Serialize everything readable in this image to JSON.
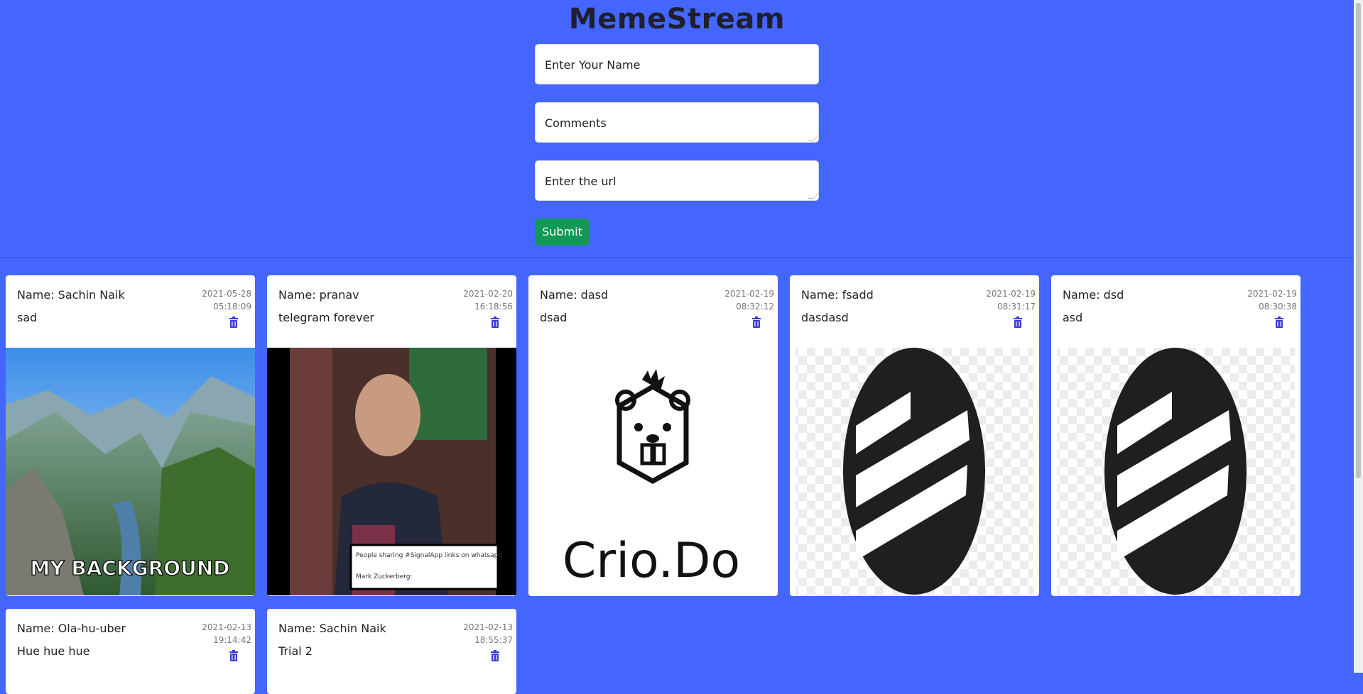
{
  "app": {
    "title": "MemeStream"
  },
  "form": {
    "name_placeholder": "Enter Your Name",
    "comments_placeholder": "Comments",
    "url_placeholder": "Enter the url",
    "submit_label": "Submit"
  },
  "colors": {
    "background": "#4466ff",
    "submit": "#119955",
    "trash": "#3b3bd8"
  },
  "posts": [
    {
      "name": "Name: Sachin Naik",
      "comment": "sad",
      "date": "2021-05-28",
      "time": "05:18:09",
      "image_caption": "MY BACKGROUND",
      "image": "mountain-landscape"
    },
    {
      "name": "Name: pranav",
      "comment": "telegram forever",
      "date": "2021-02-20",
      "time": "16:18:56",
      "image_caption_1": "People sharing #SignalApp links on whatsapp",
      "image_caption_2": "Mark Zuckerberg:",
      "image": "meme-photo"
    },
    {
      "name": "Name: dasd",
      "comment": "dsad",
      "date": "2021-02-19",
      "time": "08:32:12",
      "image_caption": "Crio.Do",
      "image": "crio-logo"
    },
    {
      "name": "Name: fsadd",
      "comment": "dasdasd",
      "date": "2021-02-19",
      "time": "08:31:17",
      "image": "striped-oval-logo"
    },
    {
      "name": "Name: dsd",
      "comment": "asd",
      "date": "2021-02-19",
      "time": "08:30:38",
      "image": "striped-oval-logo"
    },
    {
      "name": "Name: Ola-hu-uber",
      "comment": "Hue hue hue",
      "date": "2021-02-13",
      "time": "19:14:42"
    },
    {
      "name": "Name: Sachin Naik",
      "comment": "Trial 2",
      "date": "2021-02-13",
      "time": "18:55:37"
    }
  ]
}
